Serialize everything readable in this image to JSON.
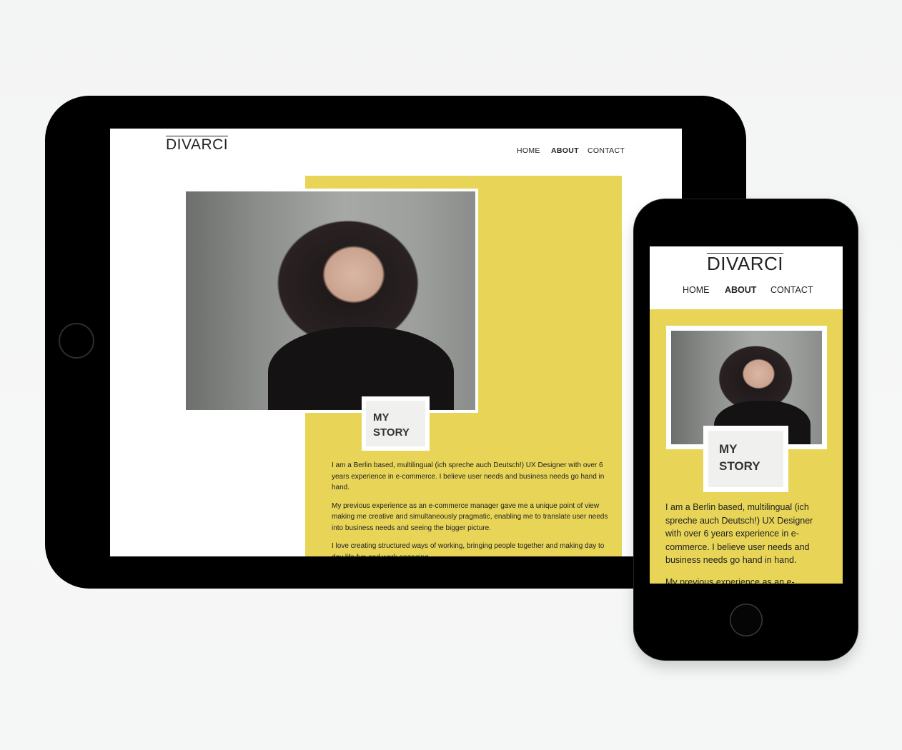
{
  "tablet": {
    "site": {
      "logo": "DIVARCI",
      "nav": [
        {
          "label": "HOME",
          "active": false
        },
        {
          "label": "ABOUT",
          "active": true
        },
        {
          "label": "CONTACT",
          "active": false
        }
      ],
      "story_title_line1": "MY",
      "story_title_line2": "STORY",
      "paragraphs": [
        "I am a Berlin based, multilingual (ich spreche auch Deutsch!) UX Designer with over 6 years experience in e-commerce. I believe user needs and business needs go hand in hand.",
        "My previous experience as an e-commerce manager gave me a unique point of view making me creative and simultaneously pragmatic, enabling me to translate user needs into business needs and seeing the bigger picture.",
        "I love creating structured ways of working, bringing people together and making day to day life fun and work engaging."
      ]
    }
  },
  "phone": {
    "site": {
      "logo": "DIVARCI",
      "nav": [
        {
          "label": "HOME",
          "active": false
        },
        {
          "label": "ABOUT",
          "active": true
        },
        {
          "label": "CONTACT",
          "active": false
        }
      ],
      "story_title_line1": "MY",
      "story_title_line2": "STORY",
      "paragraphs": [
        "I am a Berlin based, multilingual (ich spreche auch Deutsch!) UX Designer with over 6 years experience in e-commerce. I believe user needs and business needs go hand in hand.",
        "My previous experience as an e-"
      ]
    }
  },
  "colors": {
    "accent_yellow": "#e8d558",
    "device_black": "#000000",
    "story_box": "#f0f0ee"
  }
}
